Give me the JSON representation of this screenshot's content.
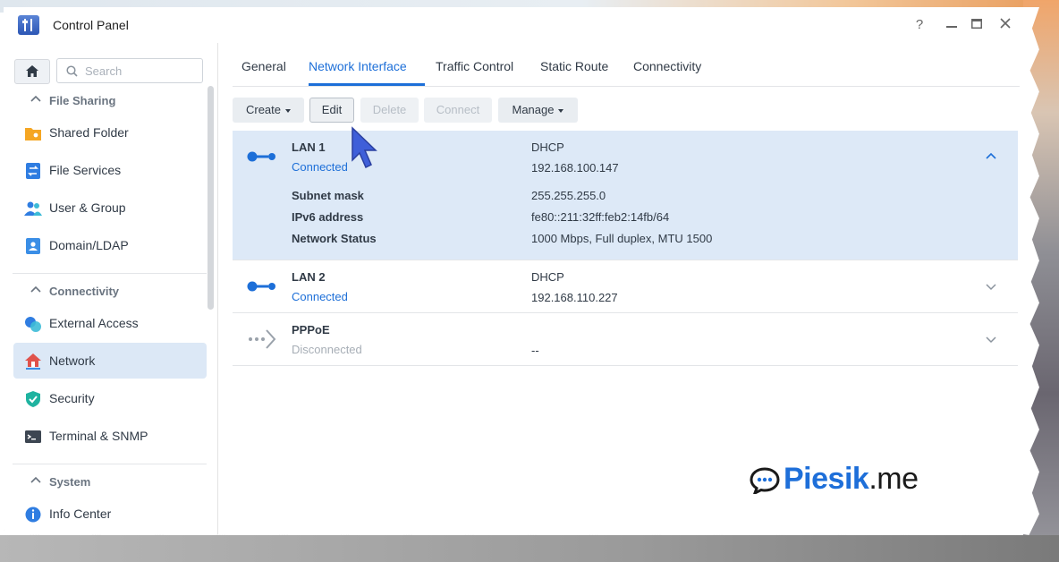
{
  "window": {
    "title": "Control Panel",
    "help_icon": "?",
    "maximize_icon": "maximize-icon",
    "close_icon": "close-icon"
  },
  "sidebar": {
    "search_placeholder": "Search",
    "sections": [
      {
        "label": "File Sharing",
        "items": [
          {
            "label": "Shared Folder",
            "icon": "shared-folder-icon"
          },
          {
            "label": "File Services",
            "icon": "file-services-icon"
          },
          {
            "label": "User & Group",
            "icon": "user-group-icon"
          },
          {
            "label": "Domain/LDAP",
            "icon": "domain-ldap-icon"
          }
        ]
      },
      {
        "label": "Connectivity",
        "items": [
          {
            "label": "External Access",
            "icon": "external-access-icon"
          },
          {
            "label": "Network",
            "icon": "network-icon",
            "active": true
          },
          {
            "label": "Security",
            "icon": "security-icon"
          },
          {
            "label": "Terminal & SNMP",
            "icon": "terminal-icon"
          }
        ]
      },
      {
        "label": "System",
        "items": [
          {
            "label": "Info Center",
            "icon": "info-icon"
          }
        ]
      }
    ]
  },
  "tabs": [
    "General",
    "Network Interface",
    "Traffic Control",
    "Static Route",
    "Connectivity"
  ],
  "active_tab": "Network Interface",
  "toolbar": {
    "create": "Create",
    "edit": "Edit",
    "delete": "Delete",
    "connect": "Connect",
    "manage": "Manage"
  },
  "interfaces": [
    {
      "name": "LAN 1",
      "status": "Connected",
      "mode": "DHCP",
      "address": "192.168.100.147",
      "expanded": true,
      "details": [
        {
          "label": "Subnet mask",
          "value": "255.255.255.0"
        },
        {
          "label": "IPv6 address",
          "value": "fe80::211:32ff:feb2:14fb/64"
        },
        {
          "label": "Network Status",
          "value": "1000 Mbps, Full duplex, MTU 1500"
        }
      ]
    },
    {
      "name": "LAN 2",
      "status": "Connected",
      "mode": "DHCP",
      "address": "192.168.110.227"
    },
    {
      "name": "PPPoE",
      "status": "Disconnected",
      "mode": "",
      "address": "--"
    }
  ],
  "watermark": {
    "part1": "Piesik",
    "part2": ".me"
  },
  "colors": {
    "accent": "#1d6fd8",
    "selected_row": "#dde9f7",
    "sidebar_active": "#dce8f6"
  }
}
